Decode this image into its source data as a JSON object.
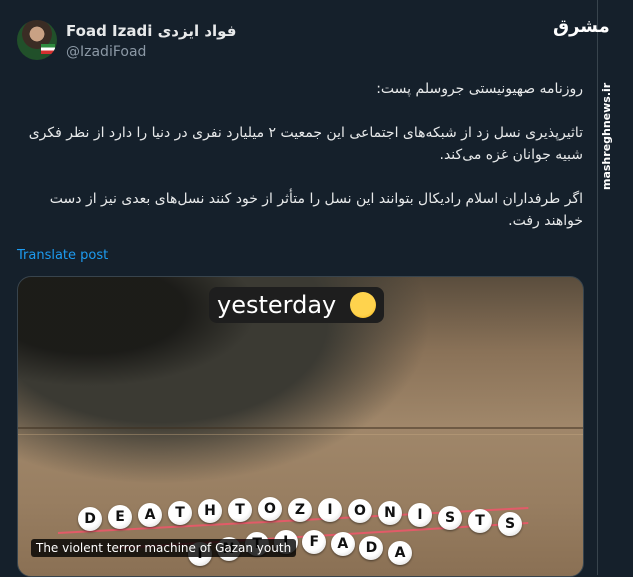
{
  "author": {
    "name": "Foad Izadi فواد ایزدی",
    "handle": "@IzadiFoad"
  },
  "watermark": {
    "logo": "مشرق",
    "url": "mashreghnews.ir"
  },
  "tweet": {
    "line1": "روزنامه صهیونیستی جروسلم پست:",
    "line2": "تاثیرپذیری نسل زد از شبکه‌های اجتماعی این جمعیت ۲ میلیارد نفری در دنیا را دارد از نظر فکری شبیه جوانان غزه می‌کند.",
    "line3": "اگر طرفداران اسلام رادیکال بتوانند این نسل را متأثر از خود کنند نسل‌های بعدی نیز از دست خواهند رفت."
  },
  "translate_label": "Translate post",
  "media": {
    "overlay_text": "yesterday",
    "bracelet1": "DEATHTOZIONISTS",
    "bracelet2": "INTIFADA",
    "caption": "The violent terror machine of Gazan youth"
  }
}
